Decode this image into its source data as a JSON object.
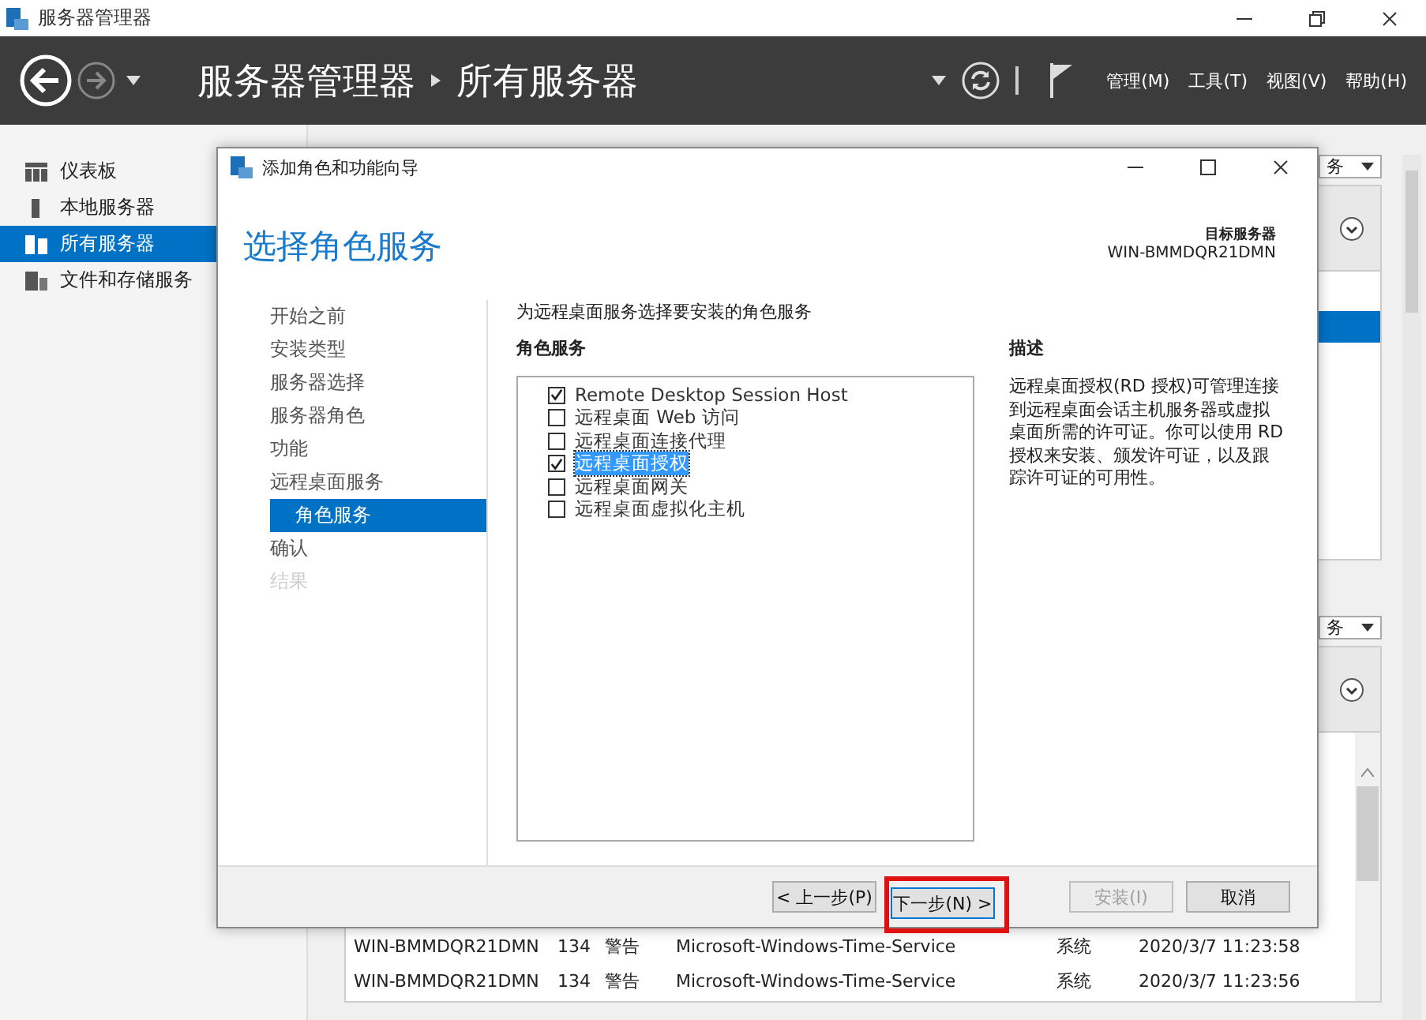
{
  "window": {
    "title": "服务器管理器"
  },
  "header": {
    "breadcrumb": [
      "服务器管理器",
      "所有服务器"
    ],
    "menus": [
      "管理(M)",
      "工具(T)",
      "视图(V)",
      "帮助(H)"
    ]
  },
  "sidebar": {
    "items": [
      {
        "label": "仪表板",
        "selected": false,
        "kind": "dashboard"
      },
      {
        "label": "本地服务器",
        "selected": false,
        "kind": "server"
      },
      {
        "label": "所有服务器",
        "selected": true,
        "kind": "servers"
      },
      {
        "label": "文件和存储服务",
        "selected": false,
        "kind": "storage"
      }
    ]
  },
  "panels": [
    {
      "dropdown": "务"
    },
    {
      "dropdown": "务"
    }
  ],
  "events_table": {
    "rows": [
      [
        "WIN-BMMDQR21DMN",
        "134",
        "警告",
        "Microsoft-Windows-Time-Service",
        "系统",
        "2020/3/7 11:23:58"
      ],
      [
        "WIN-BMMDQR21DMN",
        "134",
        "警告",
        "Microsoft-Windows-Time-Service",
        "系统",
        "2020/3/7 11:23:56"
      ]
    ]
  },
  "wizard": {
    "title": "添加角色和功能向导",
    "heading": "选择角色服务",
    "target_label": "目标服务器",
    "target_server": "WIN-BMMDQR21DMN",
    "steps": [
      {
        "label": "开始之前",
        "selected": false,
        "disabled": false
      },
      {
        "label": "安装类型",
        "selected": false,
        "disabled": false
      },
      {
        "label": "服务器选择",
        "selected": false,
        "disabled": false
      },
      {
        "label": "服务器角色",
        "selected": false,
        "disabled": false
      },
      {
        "label": "功能",
        "selected": false,
        "disabled": false
      },
      {
        "label": "远程桌面服务",
        "selected": false,
        "disabled": false,
        "children": [
          {
            "label": "角色服务",
            "selected": true,
            "disabled": false
          }
        ]
      },
      {
        "label": "确认",
        "selected": false,
        "disabled": false
      },
      {
        "label": "结果",
        "selected": false,
        "disabled": true
      }
    ],
    "instruction": "为远程桌面服务选择要安装的角色服务",
    "list_label": "角色服务",
    "role_services": [
      {
        "label": "Remote Desktop Session Host",
        "checked": true,
        "selected": false
      },
      {
        "label": "远程桌面 Web 访问",
        "checked": false,
        "selected": false
      },
      {
        "label": "远程桌面连接代理",
        "checked": false,
        "selected": false
      },
      {
        "label": "远程桌面授权",
        "checked": true,
        "selected": true
      },
      {
        "label": "远程桌面网关",
        "checked": false,
        "selected": false
      },
      {
        "label": "远程桌面虚拟化主机",
        "checked": false,
        "selected": false
      }
    ],
    "description_label": "描述",
    "description": "远程桌面授权(RD 授权)可管理连接到远程桌面会话主机服务器或虚拟桌面所需的许可证。你可以使用 RD 授权来安装、颁发许可证，以及跟踪许可证的可用性。",
    "buttons": [
      {
        "label": "< 上一步(P)",
        "disabled": false,
        "highlighted": false,
        "default": false
      },
      {
        "label": "下一步(N) >",
        "disabled": false,
        "highlighted": true,
        "default": true
      },
      {
        "label": "安装(I)",
        "disabled": true,
        "highlighted": false,
        "default": false
      },
      {
        "label": "取消",
        "disabled": false,
        "highlighted": false,
        "default": false
      }
    ]
  }
}
